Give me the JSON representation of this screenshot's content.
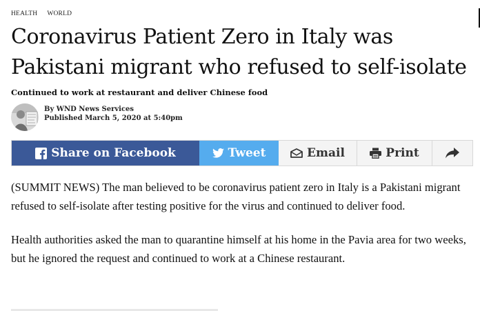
{
  "categories": [
    "HEALTH",
    "WORLD"
  ],
  "article": {
    "headline": "Coronavirus Patient Zero in Italy was Pakistani migrant who refused to self-isolate",
    "subheadline": "Continued to work at restaurant and deliver Chinese food",
    "author": "By WND News Services",
    "published": "Published March 5, 2020 at 5:40pm"
  },
  "share_bar": {
    "facebook_label": "Share on Facebook",
    "twitter_label": "Tweet",
    "email_label": "Email",
    "print_label": "Print",
    "colors": {
      "facebook": "#3b5998",
      "twitter": "#55acee",
      "neutral": "#f4f4f4"
    },
    "icons": [
      "facebook-icon",
      "twitter-icon",
      "email-icon",
      "print-icon",
      "share-arrow-icon"
    ]
  },
  "body": {
    "paragraphs": [
      "(SUMMIT NEWS) The man believed to be coronavirus patient zero in Italy is a Pakistani migrant refused to self-isolate after testing positive for the virus and continued to deliver food.",
      "Health authorities asked the man to quarantine himself at his home in the Pavia area for two weeks, but he ignored the request and continued to work at a Chinese restaurant."
    ]
  }
}
